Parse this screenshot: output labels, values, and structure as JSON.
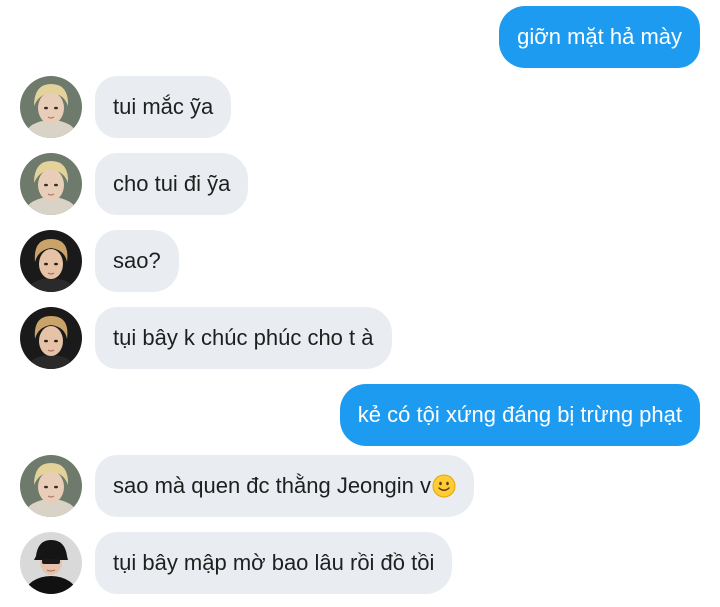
{
  "messages": [
    {
      "side": "out",
      "text": "giỡn mặt hả mày"
    },
    {
      "side": "in",
      "avatar": "avatar-blond-boy",
      "text": "tui mắc ỹa"
    },
    {
      "side": "in",
      "avatar": "avatar-blond-boy",
      "text": "cho tui đi ỹa"
    },
    {
      "side": "in",
      "avatar": "avatar-dark-boy",
      "text": "sao?"
    },
    {
      "side": "in",
      "avatar": "avatar-dark-boy",
      "text": "tụi bây k chúc phúc cho t à"
    },
    {
      "side": "out",
      "text": "kẻ có tội xứng đáng bị trừng phạt"
    },
    {
      "side": "in",
      "avatar": "avatar-blond-boy",
      "text": "sao mà quen đc thằng Jeongin v",
      "emoji": "slightly-smiling-face-emoji"
    },
    {
      "side": "in",
      "avatar": "avatar-black-cap-boy",
      "text": "tụi bây mập mờ bao lâu rồi đồ tồi"
    }
  ],
  "colors": {
    "outgoing_bubble": "#1d9bf0",
    "incoming_bubble": "#e9edf1",
    "incoming_text": "#1f1f1f",
    "outgoing_text": "#ffffff"
  }
}
